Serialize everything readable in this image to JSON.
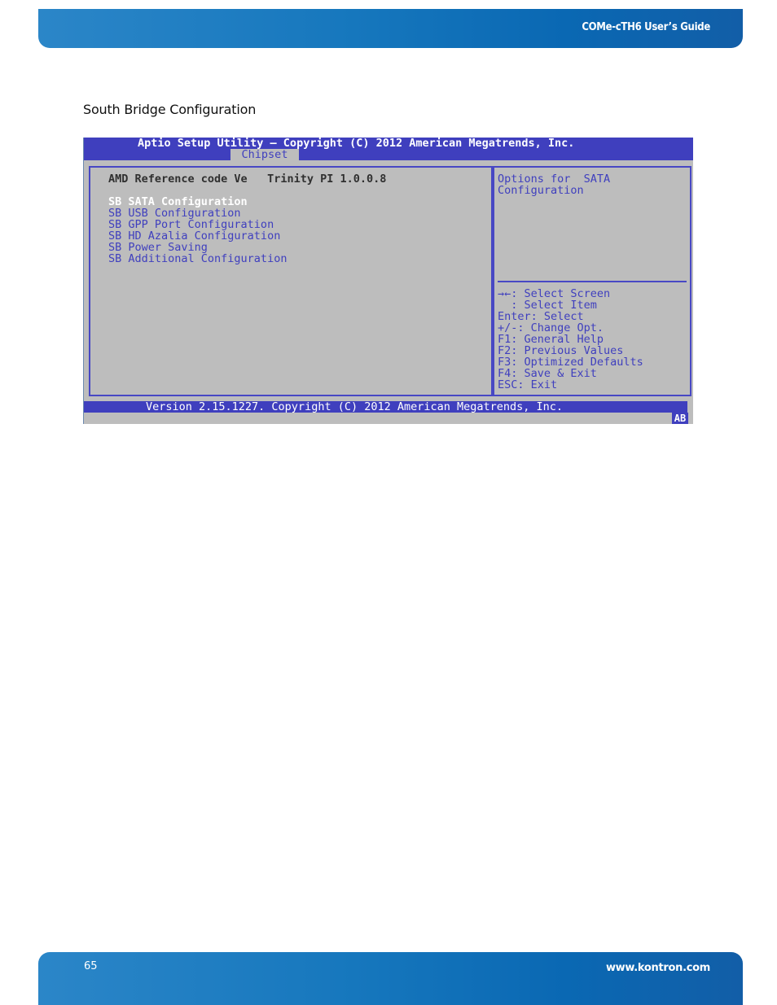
{
  "header": {
    "doc_title": "COMe-cTH6 User’s Guide"
  },
  "section_heading": "South Bridge Configuration",
  "bios": {
    "title": "Aptio Setup Utility – Copyright (C) 2012 American Megatrends, Inc.",
    "active_tab": "Chipset",
    "info_line": "AMD Reference code Ve   Trinity PI 1.0.0.8",
    "menu_items": [
      {
        "label": "SB SATA Configuration",
        "selected": true
      },
      {
        "label": "SB USB Configuration",
        "selected": false
      },
      {
        "label": "SB GPP Port Configuration",
        "selected": false
      },
      {
        "label": "SB HD Azalia Configuration",
        "selected": false
      },
      {
        "label": "SB Power Saving",
        "selected": false
      },
      {
        "label": "SB Additional Configuration",
        "selected": false
      }
    ],
    "help_text": "Options for  SATA\nConfiguration",
    "key_help": [
      "→←: Select Screen",
      "  : Select Item",
      "Enter: Select",
      "+/-: Change Opt.",
      "F1: General Help",
      "F2: Previous Values",
      "F3: Optimized Defaults",
      "F4: Save & Exit",
      "ESC: Exit"
    ],
    "footer": "Version 2.15.1227. Copyright (C) 2012 American Megatrends, Inc.",
    "badge": "AB",
    "colors": {
      "accent": "#3f3fbe",
      "background": "#bdbdbd",
      "selected_text": "#ffffff"
    }
  },
  "footer": {
    "page_number": "65",
    "website": "www.kontron.com"
  }
}
